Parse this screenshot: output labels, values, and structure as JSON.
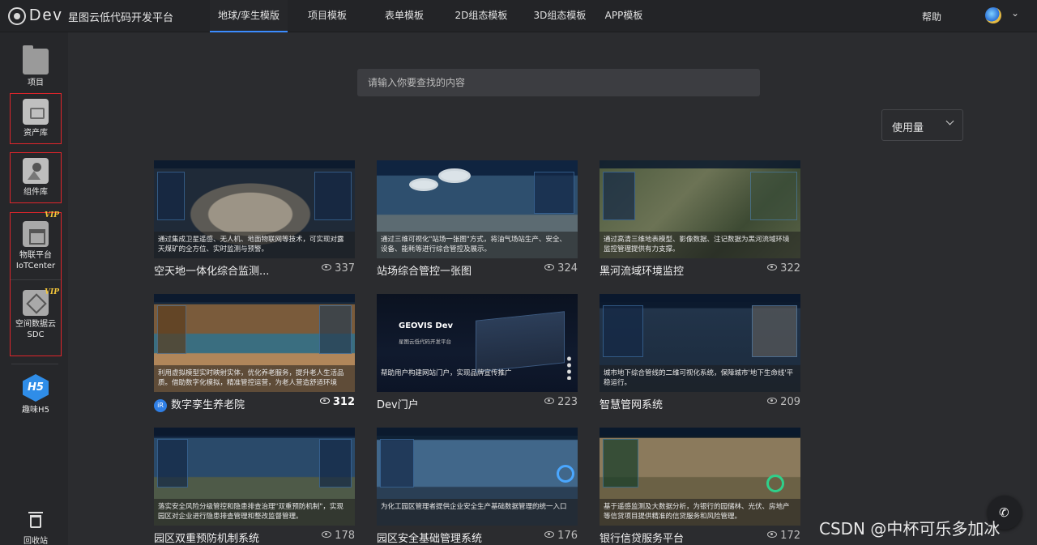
{
  "header": {
    "logo_text": "Dev",
    "app_title": "星图云低代码开发平台",
    "tabs": [
      {
        "label": "地球/孪生模版",
        "active": true
      },
      {
        "label": "项目模板",
        "active": false
      },
      {
        "label": "表单模板",
        "active": false
      },
      {
        "label": "2D组态模板",
        "active": false
      },
      {
        "label": "3D组态模板",
        "active": false
      },
      {
        "label": "APP模板",
        "active": false
      }
    ],
    "help_label": "帮助",
    "accent_color": "#3b8cff"
  },
  "sidebar": {
    "items": [
      {
        "label": "项目",
        "icon": "folder-icon"
      },
      {
        "label": "资产库",
        "icon": "asset-library-icon"
      },
      {
        "label": "组件库",
        "icon": "component-library-icon"
      },
      {
        "label": "物联平台",
        "label2": "IoTCenter",
        "icon": "iot-icon",
        "badge": "VIP"
      },
      {
        "label": "空间数据云",
        "label2": "SDC",
        "icon": "spatial-data-icon",
        "badge": "VIP"
      },
      {
        "label": "趣味H5",
        "icon": "h5-icon",
        "icon_text": "H5"
      },
      {
        "label": "回收站",
        "icon": "trash-icon"
      }
    ],
    "highlight_color": "#e0252b"
  },
  "search": {
    "placeholder": "请输入你要查找的内容",
    "value": ""
  },
  "sort": {
    "selected": "使用量"
  },
  "cards": [
    {
      "title": "空天地一体化综合监测...",
      "views": "337",
      "desc": "通过集成卫星遥感、无人机、地面物联网等技术，可实现对露天煤矿的全方位、实时监测与预警。"
    },
    {
      "title": "站场综合管控一张图",
      "views": "324",
      "desc": "通过三维可视化\"站场一张图\"方式，将油气场站生产、安全、设备、能耗等进行综合管控及展示。"
    },
    {
      "title": "黑河流域环境监控",
      "views": "322",
      "desc": "通过高清三维地表模型、影像数据、注记数据为黑河流域环境监控管理提供有力支撑。"
    },
    {
      "title": "数字孪生养老院",
      "views": "312",
      "badge": "iR",
      "desc": "利用虚拟模型实时映射实体，优化养老服务，提升老人生活品质。借助数字化模拟，精准管控运营，为老人营造舒适环境"
    },
    {
      "title": "Dev门户",
      "views": "223",
      "desc": "帮助用户构建网站门户，实现品牌宣传推广",
      "thumb_title": "GEOVIS Dev",
      "thumb_sub": "星图云低代码开发平台"
    },
    {
      "title": "智慧管网系统",
      "views": "209",
      "desc": "城市地下综合管线的二维可视化系统，保障城市'地下生命线'平稳运行。"
    },
    {
      "title": "园区双重预防机制系统",
      "views": "178",
      "desc": "落实安全风险分级管控和隐患排查治理\"双重预防机制\"，实现园区对企业进行隐患排查管理和整改监督管理。"
    },
    {
      "title": "园区安全基础管理系统",
      "views": "176",
      "desc": "为化工园区管理者提供企业安全生产基础数据管理的统一入口"
    },
    {
      "title": "银行信贷服务平台",
      "views": "172",
      "desc": "基于遥感监测及大数据分析，为银行的园储林、光伏、房地产等信贷项目提供精准的信贷服务和风险管理。"
    }
  ],
  "watermark": "CSDN @中杯可乐多加冰"
}
